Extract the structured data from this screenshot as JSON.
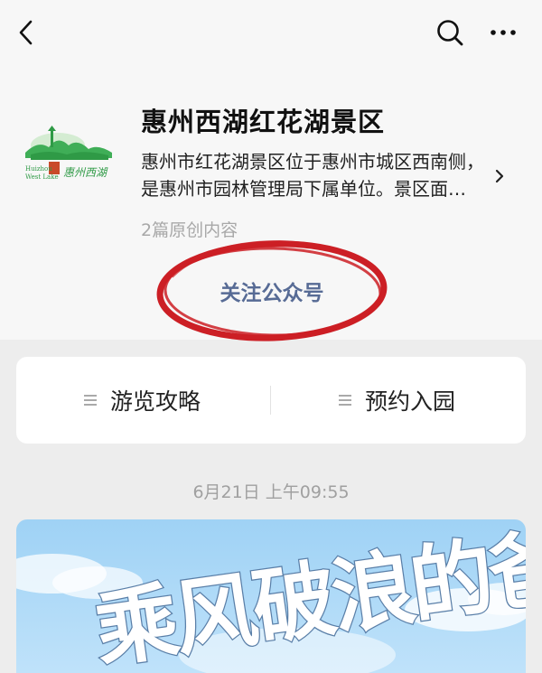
{
  "nav": {
    "back_icon": "chevron-left-icon",
    "search_icon": "search-icon",
    "more_icon": "more-horizontal-icon"
  },
  "account": {
    "name": "惠州西湖红花湖景区",
    "description_line1": "惠州市红花湖景区位于惠州市城区西南侧，",
    "description_line2": "是惠州市园林管理局下属单位。景区面…",
    "original_count": "2篇原创内容",
    "follow_label": "关注公众号",
    "logo": {
      "text_en_line1": "Huizhou",
      "text_en_line2": "West Lake",
      "text_cn": "惠州西湖"
    }
  },
  "menu": {
    "items": [
      {
        "label": "游览攻略",
        "icon": "menu-list-icon"
      },
      {
        "label": "预约入园",
        "icon": "menu-list-icon"
      }
    ]
  },
  "feed": {
    "timestamp": "6月21日 上午09:55",
    "article_title_art": "乘风破浪的爸"
  },
  "colors": {
    "link": "#576b95",
    "annotation": "#cc1f25",
    "page_bg": "#ededed",
    "header_bg": "#f7f7f7",
    "logo_green": "#2f9a46"
  }
}
